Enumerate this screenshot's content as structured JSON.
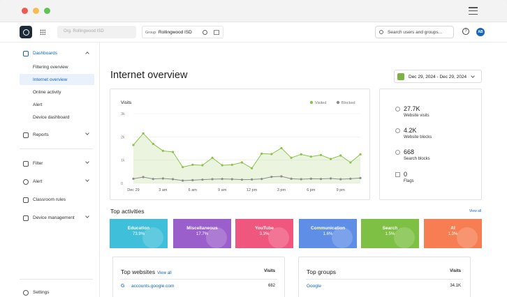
{
  "app": {
    "org_placeholder": "Org. Rollingwood ISD",
    "group_label": "Group",
    "group_value": "Rollingwood ISD",
    "search_placeholder": "Search users and groups...",
    "user_initials": "AB"
  },
  "sidebar": {
    "sections": [
      {
        "label": "Dashboards",
        "icon": "dashboard-icon",
        "expanded": true
      },
      {
        "label": "Reports",
        "icon": "reports-icon"
      },
      {
        "label": "Filter",
        "icon": "filter-icon"
      },
      {
        "label": "Alert",
        "icon": "alert-icon"
      },
      {
        "label": "Classroom rules",
        "icon": "classroom-icon"
      },
      {
        "label": "Device management",
        "icon": "device-icon"
      }
    ],
    "dashboards_items": [
      "Filtering overview",
      "Internet overview",
      "Online activity",
      "Alert",
      "Device dashboard"
    ],
    "active_item": "Internet overview",
    "settings_label": "Settings"
  },
  "main": {
    "title": "Internet overview",
    "date_range": "Dec 29, 2024 - Dec 29, 2024"
  },
  "chart_data": {
    "type": "line",
    "title": "Visits",
    "x": [
      "Dec 29",
      "",
      "",
      "3 am",
      "",
      "",
      "6 am",
      "",
      "",
      "9 am",
      "",
      "",
      "12 pm",
      "",
      "",
      "3 pm",
      "",
      "",
      "6 pm",
      "",
      "",
      "9 pm",
      "",
      ""
    ],
    "xticks": [
      "Dec 29",
      "3 am",
      "6 am",
      "9 am",
      "12 pm",
      "3 pm",
      "6 pm",
      "9 pm"
    ],
    "yticks": [
      "0",
      "1k",
      "2k",
      "3k"
    ],
    "ylim": [
      0,
      3000
    ],
    "series": [
      {
        "name": "Visited",
        "color": "#8bc34a",
        "values": [
          1650,
          2150,
          1700,
          1400,
          1350,
          700,
          800,
          780,
          1100,
          780,
          800,
          900,
          650,
          1280,
          1260,
          1520,
          1100,
          1250,
          1150,
          1220,
          1050,
          1200,
          900,
          1250
        ]
      },
      {
        "name": "Blocked",
        "color": "#8d8d8d",
        "values": [
          200,
          270,
          190,
          210,
          180,
          120,
          140,
          160,
          180,
          190,
          180,
          160,
          170,
          190,
          280,
          300,
          200,
          180,
          200,
          190,
          210,
          180,
          200,
          230
        ]
      }
    ],
    "grid": true,
    "legend": "top-right"
  },
  "stats": [
    {
      "value": "27.7K",
      "label": "Website visits",
      "icon": "globe-icon"
    },
    {
      "value": "4.2K",
      "label": "Website blocks",
      "icon": "blocked-icon"
    },
    {
      "value": "668",
      "label": "Search blocks",
      "icon": "search-icon"
    },
    {
      "value": "0",
      "label": "Flags",
      "icon": "flag-icon"
    }
  ],
  "top_activities": {
    "title": "Top activities",
    "view_all": "View all",
    "tiles": [
      {
        "name": "Education",
        "pct": "73.9%",
        "color": "#3fbfd9"
      },
      {
        "name": "Miscellaneous",
        "pct": "17.7%",
        "color": "#9b5fcb"
      },
      {
        "name": "YouTube",
        "pct": "3.3%",
        "color": "#f0577f"
      },
      {
        "name": "Communication",
        "pct": "1.6%",
        "color": "#5f8ee6"
      },
      {
        "name": "Search",
        "pct": "1.5%",
        "color": "#7dc044"
      },
      {
        "name": "AI",
        "pct": "1.3%",
        "color": "#f77e52"
      }
    ]
  },
  "top_websites": {
    "title": "Top websites",
    "view_all": "View all",
    "column": "Visits",
    "rows": [
      {
        "name": "accounts.google.com",
        "value": "682"
      }
    ]
  },
  "top_groups": {
    "title": "Top groups",
    "column": "Visits",
    "rows": [
      {
        "name": "Google",
        "value": "34.1K"
      }
    ]
  }
}
